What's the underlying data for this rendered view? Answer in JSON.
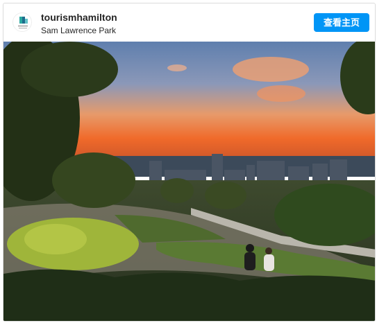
{
  "post": {
    "username": "tourismhamilton",
    "location": "Sam Lawrence Park",
    "view_profile_label": "查看主页"
  },
  "icons": {
    "avatar": "tourism-hamilton-logo-icon"
  },
  "colors": {
    "button": "#0095f6",
    "sky_top": "#6d87b0",
    "sunset": "#f06a2a"
  }
}
